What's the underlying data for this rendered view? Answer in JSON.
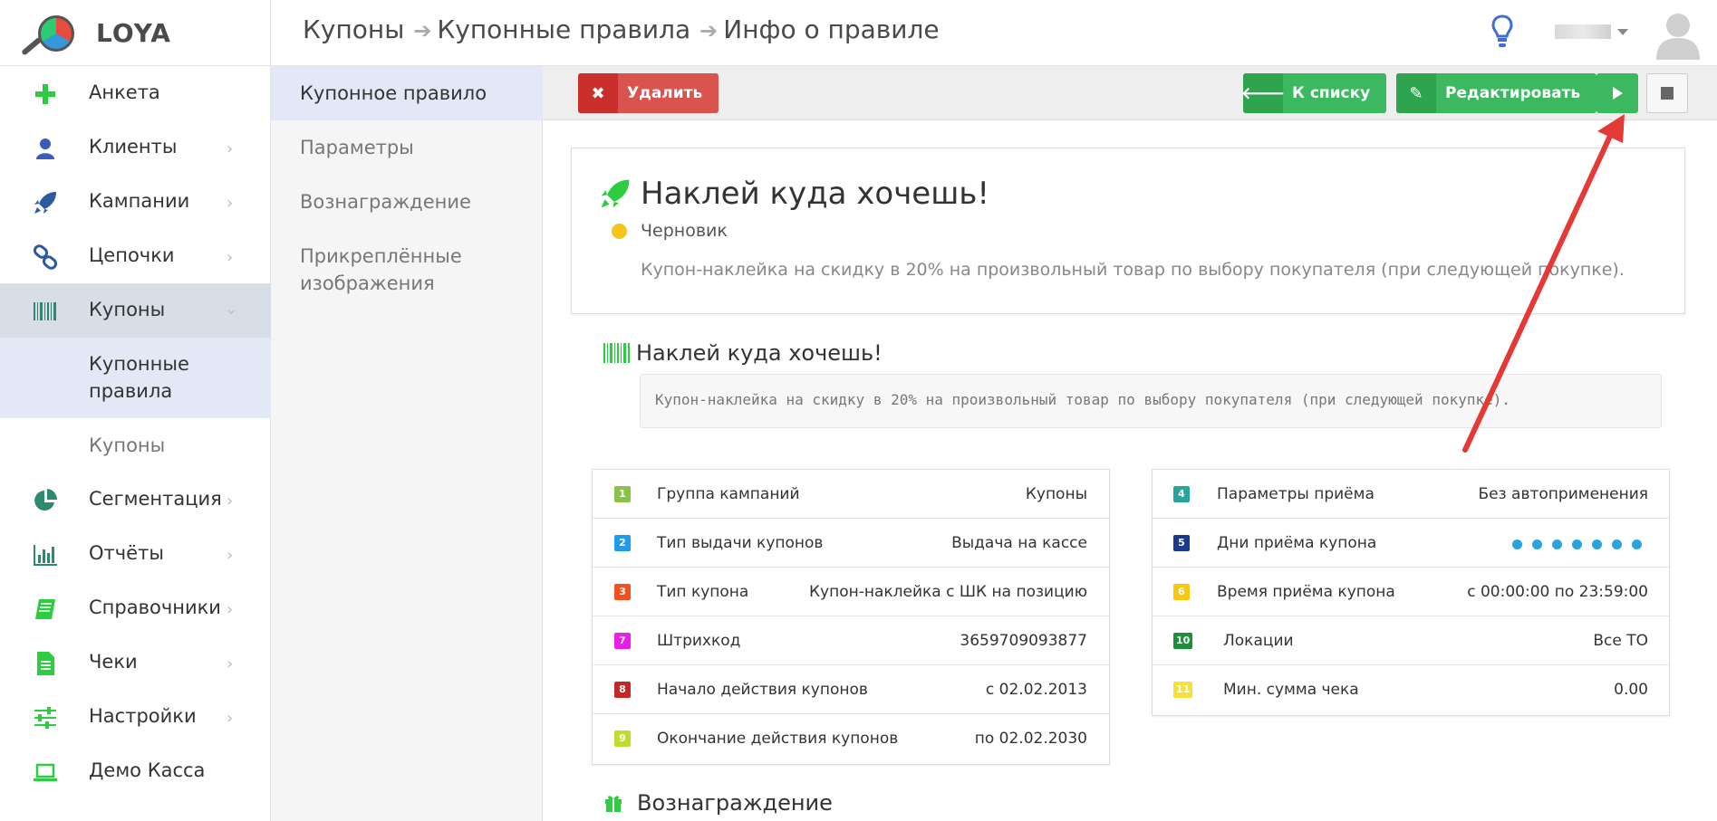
{
  "app": {
    "logo_text": "LOYA"
  },
  "header": {
    "breadcrumb": [
      "Купоны",
      "Купонные правила",
      "Инфо о правиле"
    ]
  },
  "sidebar": {
    "items": [
      {
        "label": "Анкета",
        "icon": "plus-icon"
      },
      {
        "label": "Клиенты",
        "icon": "user-icon"
      },
      {
        "label": "Кампании",
        "icon": "rocket-icon"
      },
      {
        "label": "Цепочки",
        "icon": "link-icon"
      },
      {
        "label": "Купоны",
        "icon": "barcode-icon"
      },
      {
        "label": "Сегментация",
        "icon": "pie-chart-icon"
      },
      {
        "label": "Отчёты",
        "icon": "bar-chart-icon"
      },
      {
        "label": "Справочники",
        "icon": "book-icon"
      },
      {
        "label": "Чеки",
        "icon": "receipt-icon"
      },
      {
        "label": "Настройки",
        "icon": "sliders-icon"
      },
      {
        "label": "Демо Касса",
        "icon": "laptop-icon"
      }
    ],
    "sub_items": [
      "Купонные правила",
      "Купоны"
    ]
  },
  "submenu": {
    "items": [
      "Купонное правило",
      "Параметры",
      "Вознаграждение",
      "Прикреплённые изображения"
    ]
  },
  "toolbar": {
    "delete_label": "Удалить",
    "back_label": "К списку",
    "edit_label": "Редактировать"
  },
  "rule": {
    "title": "Наклей куда хочешь!",
    "status": "Черновик",
    "description": "Купон-наклейка на скидку в 20% на произвольный товар по выбору покупателя (при следующей покупке)."
  },
  "coupon": {
    "title": "Наклей куда хочешь!",
    "text": "Купон-наклейка на скидку в 20% на произвольный товар по выбору покупателя (при следующей покупке)."
  },
  "params_left": [
    {
      "num": "1",
      "color": "#8bc34a",
      "name": "Группа кампаний",
      "value": "Купоны"
    },
    {
      "num": "2",
      "color": "#1e9be9",
      "name": "Тип выдачи купонов",
      "value": "Выдача на кассе"
    },
    {
      "num": "3",
      "color": "#f4511e",
      "name": "Тип купона",
      "value": "Купон-наклейка с ШК на позицию"
    },
    {
      "num": "7",
      "color": "#e91ee9",
      "name": "Штрихкод",
      "value": "3659709093877"
    },
    {
      "num": "8",
      "color": "#c62828",
      "name": "Начало действия купонов",
      "value": "с 02.02.2013"
    },
    {
      "num": "9",
      "color": "#c0dc2c",
      "name": "Окончание действия купонов",
      "value": "по 02.02.2030"
    }
  ],
  "params_right": [
    {
      "num": "4",
      "color": "#26a69a",
      "name": "Параметры приёма",
      "value": "Без автоприменения"
    },
    {
      "num": "5",
      "color": "#1a3a8f",
      "name": "Дни приёма купона",
      "value": "",
      "dots": 7
    },
    {
      "num": "6",
      "color": "#f9c80e",
      "name": "Время приёма купона",
      "value": "с 00:00:00 по 23:59:00"
    },
    {
      "num": "10",
      "color": "#1b8f3a",
      "name": "Локации",
      "value": "Все ТО"
    },
    {
      "num": "11",
      "color": "#f5e13a",
      "name": "Мин. сумма чека",
      "value": "0.00"
    }
  ],
  "reward": {
    "title": "Вознаграждение"
  },
  "colors": {
    "accent_green": "#3cb860",
    "danger": "#d9534f",
    "annotation_arrow": "#e53935"
  }
}
